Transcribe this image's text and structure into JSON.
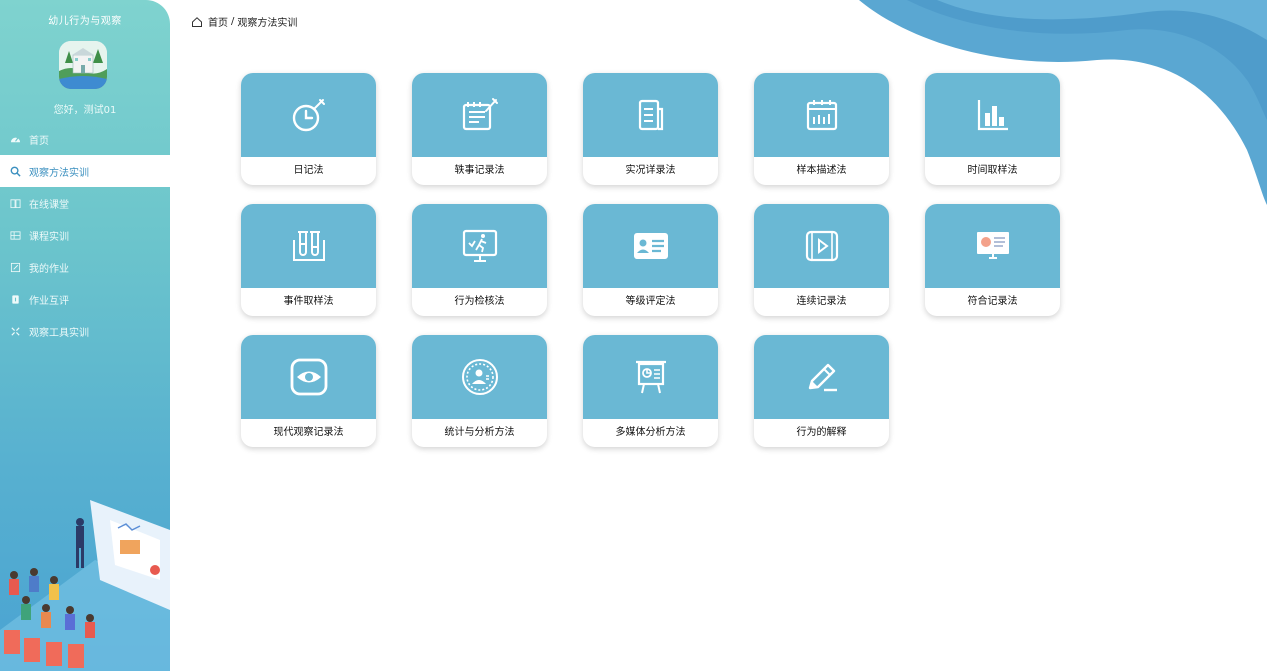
{
  "app": {
    "title": "幼儿行为与观察",
    "greeting": "您好，测试01"
  },
  "sidebar": {
    "items": [
      {
        "label": "首页",
        "icon": "dashboard-icon"
      },
      {
        "label": "观察方法实训",
        "icon": "search-icon",
        "active": true
      },
      {
        "label": "在线课堂",
        "icon": "book-icon"
      },
      {
        "label": "课程实训",
        "icon": "grid-icon"
      },
      {
        "label": "我的作业",
        "icon": "edit-icon"
      },
      {
        "label": "作业互评",
        "icon": "badge-icon"
      },
      {
        "label": "观察工具实训",
        "icon": "tools-icon"
      }
    ]
  },
  "breadcrumb": {
    "home": "首页",
    "separator": "/",
    "current": "观察方法实训"
  },
  "colors": {
    "card_top": "#6ab8d4",
    "sidebar_start": "#7fd3cf",
    "sidebar_end": "#4aa3d2",
    "wave": "#5da9d3"
  },
  "cards": [
    {
      "label": "日记法",
      "icon": "clock-pen-icon"
    },
    {
      "label": "轶事记录法",
      "icon": "notepad-pen-icon"
    },
    {
      "label": "实况详录法",
      "icon": "document-icon"
    },
    {
      "label": "样本描述法",
      "icon": "calendar-icon"
    },
    {
      "label": "时间取样法",
      "icon": "bar-chart-icon"
    },
    {
      "label": "事件取样法",
      "icon": "test-tubes-icon"
    },
    {
      "label": "行为检核法",
      "icon": "monitor-runner-icon"
    },
    {
      "label": "等级评定法",
      "icon": "id-card-icon"
    },
    {
      "label": "连续记录法",
      "icon": "video-icon"
    },
    {
      "label": "符合记录法",
      "icon": "screen-chart-icon"
    },
    {
      "label": "现代观察记录法",
      "icon": "eye-icon"
    },
    {
      "label": "统计与分析方法",
      "icon": "user-circle-icon"
    },
    {
      "label": "多媒体分析方法",
      "icon": "presentation-icon"
    },
    {
      "label": "行为的解释",
      "icon": "pencil-line-icon"
    }
  ]
}
